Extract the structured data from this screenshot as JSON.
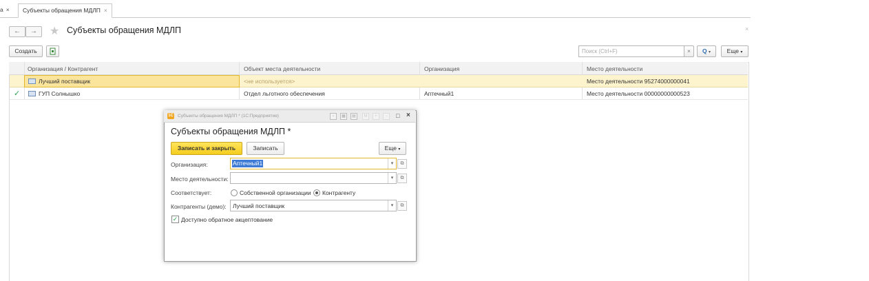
{
  "tabs": {
    "prev_label": "а",
    "prev_close": "×",
    "active_label": "Субъекты обращения МДЛП",
    "active_close": "×"
  },
  "nav": {
    "back": "←",
    "forward": "→"
  },
  "page": {
    "title": "Субъекты обращения МДЛП",
    "close": "×"
  },
  "toolbar": {
    "create_label": "Создать",
    "search_placeholder": "Поиск (Ctrl+F)",
    "clear_search": "×",
    "search_button": "Q",
    "more_label": "Еще"
  },
  "table": {
    "columns": [
      "Организация / Контрагент",
      "Объект места деятельности",
      "Организация",
      "Место деятельности"
    ],
    "rows": [
      {
        "status": "",
        "counterparty": "Лучший поставщик",
        "object": "<не используется>",
        "organization": "",
        "place": "Место деятельности 95274000000041"
      },
      {
        "status": "✓",
        "counterparty": "ГУП Солнышко",
        "object": "Отдел льготного обеспечения",
        "organization": "Аптечный1",
        "place": "Место деятельности 00000000000523"
      }
    ]
  },
  "dialog": {
    "app_badge": "1С",
    "window_title": "Субъекты обращения МДЛП * (1С:Предприятие)",
    "heading": "Субъекты обращения МДЛП *",
    "save_close_label": "Записать и закрыть",
    "save_label": "Записать",
    "more_label": "Еще",
    "org_label": "Организация:",
    "org_value": "Аптечный1",
    "place_label": "Место деятельности:",
    "place_value": "",
    "corresponds_label": "Соответствует:",
    "radio_own": "Собственной организации",
    "radio_counterparty": "Контрагенту",
    "radio_selected": "Контрагенту",
    "counterparty_label": "Контрагенты (демо):",
    "counterparty_value": "Лучший поставщик",
    "checkbox_label": "Доступно обратное акцептование",
    "checkbox_checked": true
  },
  "colors": {
    "accent_yellow": "#f4cd1d",
    "selected_row": "#fdf3cd",
    "check_green": "#2aa04a"
  }
}
